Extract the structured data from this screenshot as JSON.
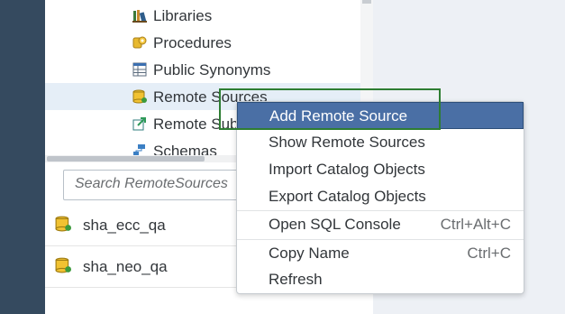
{
  "tree": {
    "items": [
      {
        "label": "Libraries",
        "icon": "books-icon"
      },
      {
        "label": "Procedures",
        "icon": "procedure-icon"
      },
      {
        "label": "Public Synonyms",
        "icon": "synonym-icon"
      },
      {
        "label": "Remote Sources",
        "icon": "remote-source-icon"
      },
      {
        "label": "Remote Subscriptions",
        "icon": "remote-subscription-icon"
      },
      {
        "label": "Schemas",
        "icon": "schema-icon"
      }
    ]
  },
  "search": {
    "placeholder": "Search RemoteSources"
  },
  "list": {
    "items": [
      {
        "label": "sha_ecc_qa"
      },
      {
        "label": "sha_neo_qa"
      }
    ]
  },
  "context_menu": {
    "items": [
      {
        "label": "Add Remote Source",
        "shortcut": ""
      },
      {
        "label": "Show Remote Sources",
        "shortcut": ""
      },
      {
        "label": "Import Catalog Objects",
        "shortcut": ""
      },
      {
        "label": "Export Catalog Objects",
        "shortcut": ""
      },
      {
        "label": "Open SQL Console",
        "shortcut": "Ctrl+Alt+C"
      },
      {
        "label": "Copy Name",
        "shortcut": "Ctrl+C"
      },
      {
        "label": "Refresh",
        "shortcut": ""
      }
    ]
  },
  "colors": {
    "rail": "#354a5f",
    "selected_row": "#e5eef7",
    "menu_active": "#4a6fa5",
    "highlight_box": "#2e7d32"
  }
}
